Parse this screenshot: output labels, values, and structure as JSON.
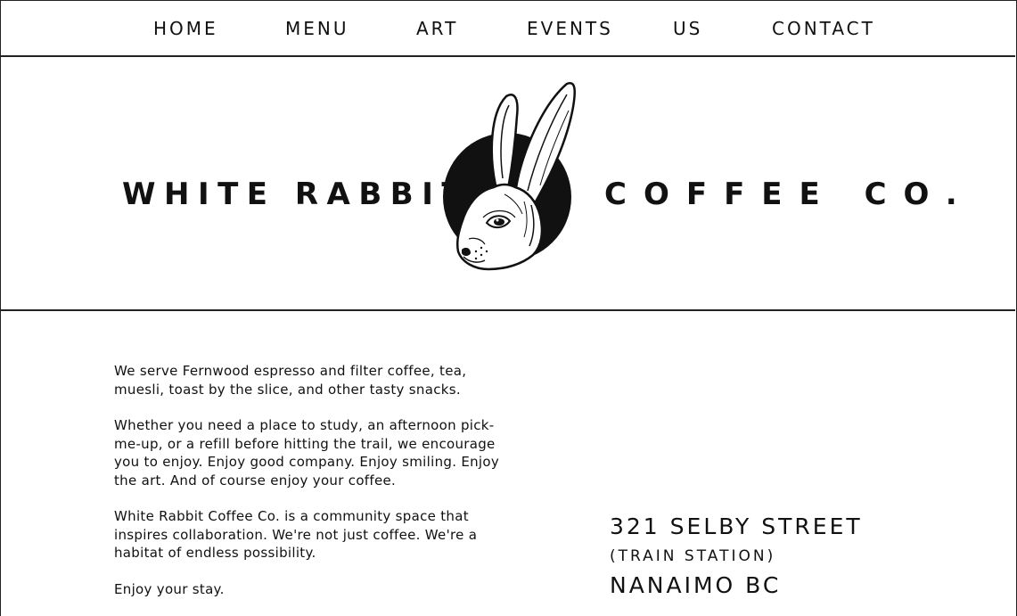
{
  "nav": {
    "items": [
      {
        "label": "HOME"
      },
      {
        "label": "MENU"
      },
      {
        "label": "ART"
      },
      {
        "label": "EVENTS"
      },
      {
        "label": "US"
      },
      {
        "label": "CONTACT"
      }
    ]
  },
  "hero": {
    "brand_left": "WHITE RABBIT",
    "brand_right": "COFFEE CO.",
    "logo_icon": "white-rabbit-head-logo"
  },
  "about": {
    "paragraphs": [
      "We serve Fernwood espresso and filter coffee, tea, muesli, toast by the slice, and other tasty snacks.",
      "Whether you need a place to study, an afternoon pick-me-up, or a refill before hitting the trail, we encourage you to enjoy. Enjoy good company. Enjoy smiling. Enjoy the art. And of course enjoy your coffee.",
      "White Rabbit Coffee Co. is a community space that inspires collaboration. We're not just coffee. We're a habitat of endless possibility.",
      "Enjoy your stay."
    ]
  },
  "address": {
    "street": "321 SELBY STREET",
    "note": "(TRAIN STATION)",
    "city": "NANAIMO BC"
  },
  "colors": {
    "text": "#111111",
    "background": "#ffffff",
    "rule": "#222222"
  }
}
